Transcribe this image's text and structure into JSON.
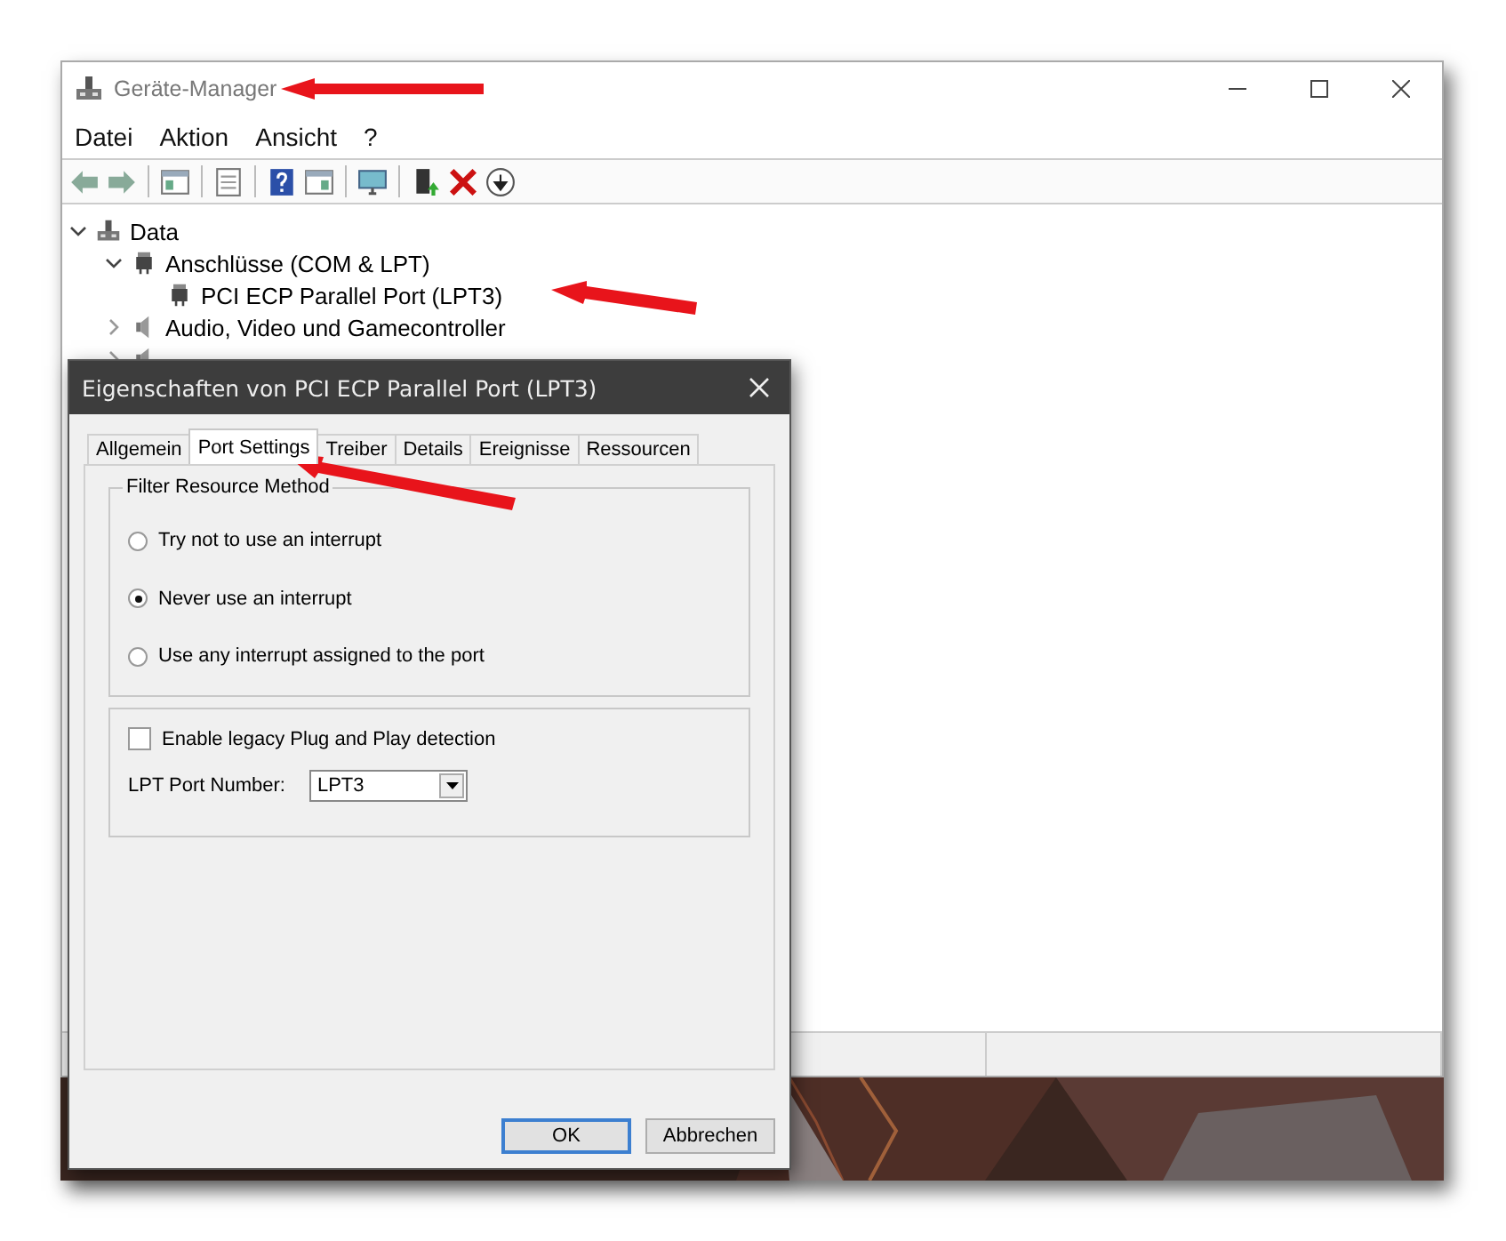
{
  "window": {
    "title": "Geräte-Manager"
  },
  "menu": [
    "Datei",
    "Aktion",
    "Ansicht",
    "?"
  ],
  "tree": [
    {
      "label": "Data",
      "kind": "computer",
      "expanded": true,
      "children": [
        {
          "label": "Anschlüsse (COM & LPT)",
          "kind": "port",
          "expanded": true,
          "children": [
            {
              "label": "PCI ECP Parallel Port (LPT3)",
              "kind": "port"
            }
          ]
        },
        {
          "label": "Audio, Video und Gamecontroller",
          "kind": "audio",
          "expanded": false
        },
        {
          "kind": "audio",
          "expanded": false
        }
      ]
    }
  ],
  "dialog": {
    "title": "Eigenschaften von PCI ECP Parallel Port (LPT3)",
    "tabs": [
      {
        "label": "Allgemein",
        "selected": false
      },
      {
        "label": "Port Settings",
        "selected": true
      },
      {
        "label": "Treiber",
        "selected": false
      },
      {
        "label": "Details",
        "selected": false
      },
      {
        "label": "Ereignisse",
        "selected": false
      },
      {
        "label": "Ressourcen",
        "selected": false
      }
    ],
    "filter_group": {
      "title": "Filter Resource Method",
      "options": [
        {
          "label": "Try not to use an interrupt",
          "selected": false
        },
        {
          "label": "Never use an interrupt",
          "selected": true
        },
        {
          "label": "Use any interrupt assigned to the port",
          "selected": false
        }
      ]
    },
    "legacy_detection": {
      "label": "Enable legacy Plug and Play detection",
      "checked": false
    },
    "port_number": {
      "label": "LPT Port Number:",
      "value": "LPT3"
    },
    "buttons": [
      {
        "label": "OK",
        "default": true
      },
      {
        "label": "Abbrechen",
        "default": false
      }
    ]
  }
}
